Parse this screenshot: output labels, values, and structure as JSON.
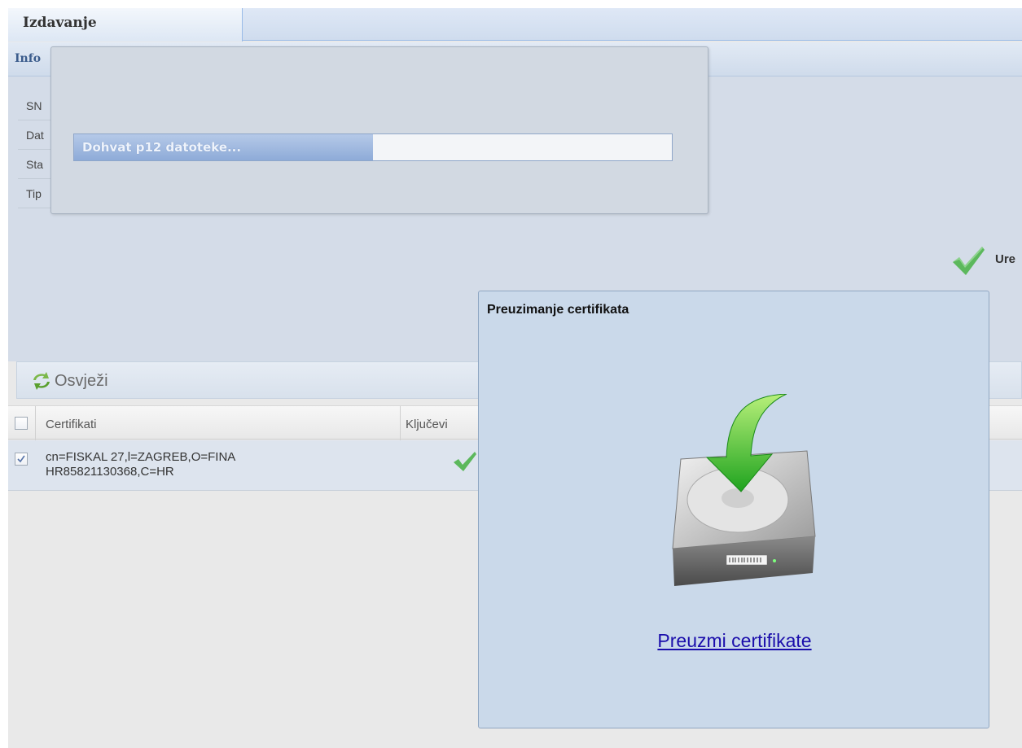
{
  "tabs": {
    "active_label": "Izdavanje"
  },
  "info": {
    "title": "Info",
    "fields": [
      {
        "label": "SN"
      },
      {
        "label": "Dat"
      },
      {
        "label": "Sta"
      },
      {
        "label": "Tip"
      }
    ],
    "status_label": "Ure"
  },
  "toolbar": {
    "refresh_label": "Osvježi",
    "refresh_icon": "refresh-icon"
  },
  "grid": {
    "columns": [
      {
        "label": "Certifikati"
      },
      {
        "label": "Ključevi"
      }
    ],
    "rows": [
      {
        "checked": true,
        "certificate": "cn=FISKAL 27,l=ZAGREB,O=FINA\nHR85821130368,C=HR",
        "keys_icon": "check-icon"
      }
    ]
  },
  "progress": {
    "text": "Dohvat p12 datoteke...",
    "percent": 50
  },
  "download_dialog": {
    "title": "Preuzimanje certifikata",
    "icon": "hard-drive-download-icon",
    "link_label": "Preuzmi certifikate"
  },
  "colors": {
    "accent": "#99bbe8",
    "link": "#1a0dab",
    "check": "#5cb85c"
  }
}
